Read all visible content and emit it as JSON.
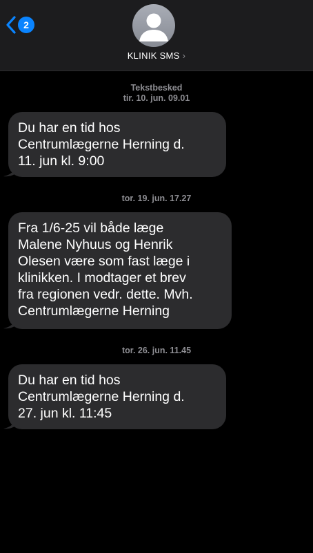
{
  "header": {
    "back_badge": "2",
    "contact_name": "KLINIK SMS",
    "chevron": "›"
  },
  "thread": {
    "first_label": "Tekstbesked",
    "messages": [
      {
        "timestamp": "tir. 10. jun. 09.01",
        "text": "Du har en tid hos\nCentrumlægerne Herning  d.\n11. jun kl. 9:00"
      },
      {
        "timestamp": "tor. 19. jun. 17.27",
        "text": "Fra 1/6-25 vil både læge\nMalene Nyhuus og Henrik\nOlesen være som fast læge i\nklinikken. I modtager et brev\nfra regionen vedr. dette. Mvh.\nCentrumlægerne Herning"
      },
      {
        "timestamp": "tor. 26. jun. 11.45",
        "text": "Du har en tid hos\nCentrumlægerne Herning  d.\n27. jun kl. 11:45"
      }
    ]
  },
  "colors": {
    "background": "#000000",
    "header_bg": "#1c1c1e",
    "bubble_bg": "#2c2c2e",
    "accent": "#0a84ff",
    "secondary_text": "#8e8e93"
  },
  "icons": {
    "back": "chevron-left-icon",
    "avatar": "person-icon",
    "disclosure": "chevron-right-icon"
  }
}
